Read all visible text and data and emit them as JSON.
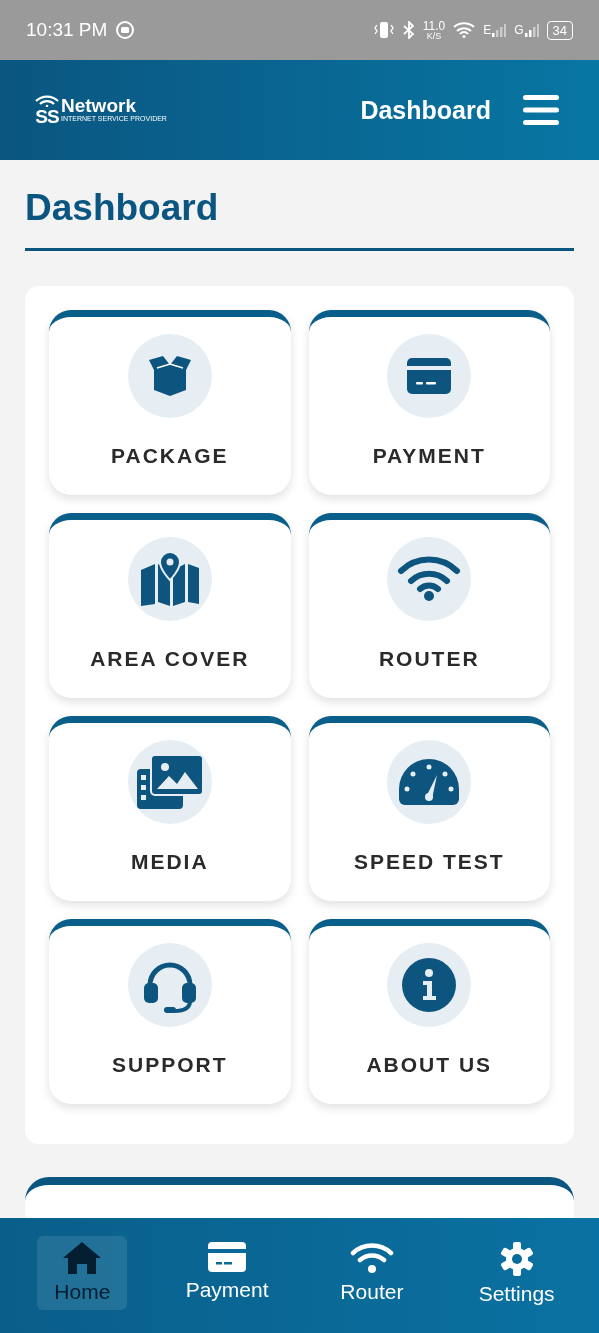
{
  "status_bar": {
    "time": "10:31 PM",
    "speed": "11.0",
    "speed_unit": "K/S",
    "network_1": "E",
    "network_2": "G",
    "battery": "34"
  },
  "header": {
    "logo": {
      "mark": "SS",
      "name": "Network",
      "tagline": "INTERNET SERVICE PROVIDER"
    },
    "title": "Dashboard"
  },
  "page_title": "Dashboard",
  "tiles": [
    {
      "label": "PACKAGE"
    },
    {
      "label": "PAYMENT"
    },
    {
      "label": "AREA COVER"
    },
    {
      "label": "ROUTER"
    },
    {
      "label": "MEDIA"
    },
    {
      "label": "SPEED TEST"
    },
    {
      "label": "SUPPORT"
    },
    {
      "label": "ABOUT US"
    }
  ],
  "bottom_nav": [
    {
      "label": "Home",
      "selected": true
    },
    {
      "label": "Payment",
      "selected": false
    },
    {
      "label": "Router",
      "selected": false
    },
    {
      "label": "Settings",
      "selected": false
    }
  ]
}
